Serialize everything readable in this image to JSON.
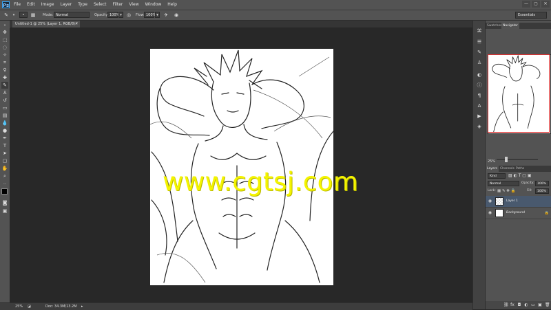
{
  "app": {
    "logo": "Ps"
  },
  "menu": [
    "File",
    "Edit",
    "Image",
    "Layer",
    "Type",
    "Select",
    "Filter",
    "View",
    "Window",
    "Help"
  ],
  "window_controls": [
    "—",
    "▢",
    "✕"
  ],
  "options": {
    "mode_label": "Mode:",
    "mode_value": "Normal",
    "opacity_label": "Opacity:",
    "opacity_value": "100%",
    "flow_label": "Flow:",
    "flow_value": "100%",
    "workspace": "Essentials"
  },
  "document": {
    "tab_title": "Untitled-1 @ 25% (Layer 1, RGB/8) *",
    "tab_close": "✕",
    "watermark": "www.cgtsj.com"
  },
  "status": {
    "zoom": "25%",
    "doc_info": "Doc: 34.3M/13.2M"
  },
  "navigator": {
    "tabs": [
      "Swatches",
      "Navigator"
    ],
    "zoom": "25%"
  },
  "layers": {
    "tabs": [
      "Layers",
      "Channels",
      "Paths"
    ],
    "kind": "Kind",
    "blend_mode": "Normal",
    "opacity_label": "Opacity:",
    "opacity_value": "100%",
    "lock_label": "Lock:",
    "fill_label": "Fill:",
    "fill_value": "100%",
    "items": [
      {
        "name": "Layer 1",
        "selected": true
      },
      {
        "name": "Background",
        "selected": false
      }
    ]
  },
  "colors": {
    "accent": "#31a8ff",
    "selection": "#49596e",
    "watermark": "#f4f400",
    "nav_view": "#e03030"
  }
}
